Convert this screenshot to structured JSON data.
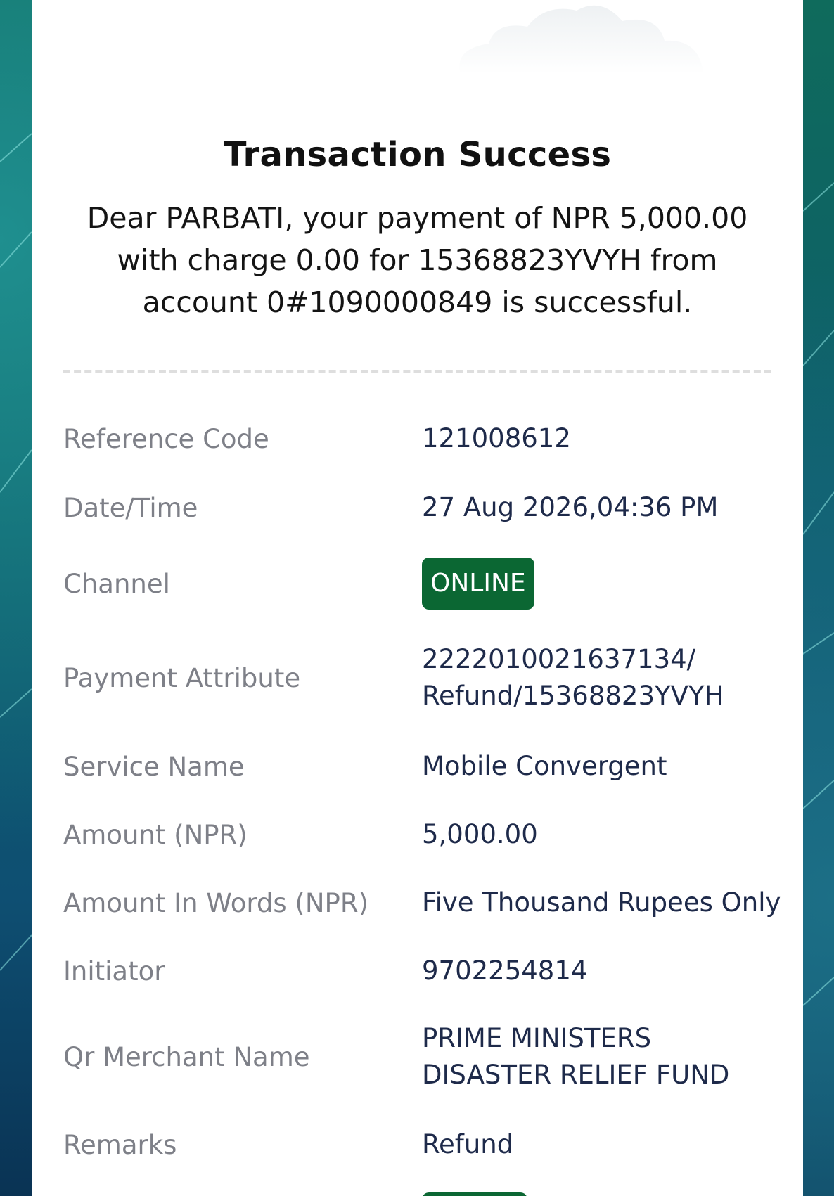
{
  "receipt": {
    "title": "Transaction Success",
    "message": "Dear PARBATI, your payment of NPR 5,000.00 with charge 0.00 for 15368823YVYH from account 0#1090000849 is successful.",
    "fields": {
      "reference_code": {
        "label": "Reference Code",
        "value": "121008612"
      },
      "date_time": {
        "label": "Date/Time",
        "value": "27 Aug 2026,04:36 PM"
      },
      "channel": {
        "label": "Channel",
        "value": "ONLINE"
      },
      "payment_attribute": {
        "label": "Payment Attribute",
        "value_line1": "2222010021637134/",
        "value_line2": "Refund/15368823YVYH"
      },
      "service_name": {
        "label": "Service Name",
        "value": "Mobile Convergent"
      },
      "amount": {
        "label": "Amount (NPR)",
        "value": "5,000.00"
      },
      "amount_in_words": {
        "label": "Amount In Words (NPR)",
        "value": "Five Thousand Rupees Only"
      },
      "initiator": {
        "label": "Initiator",
        "value": "9702254814"
      },
      "qr_merchant_name": {
        "label": "Qr Merchant Name",
        "value_line1": "PRIME MINISTERS",
        "value_line2": "DISASTER RELIEF FUND"
      },
      "remarks": {
        "label": "Remarks",
        "value": "Refund"
      }
    }
  },
  "colors": {
    "badge_green": "#0b6733",
    "label_gray": "#7e8088",
    "value_navy": "#1e2a4a",
    "background_teal": "#0d5d6a"
  },
  "icons": {
    "header_decoration": "cloud-icon"
  }
}
